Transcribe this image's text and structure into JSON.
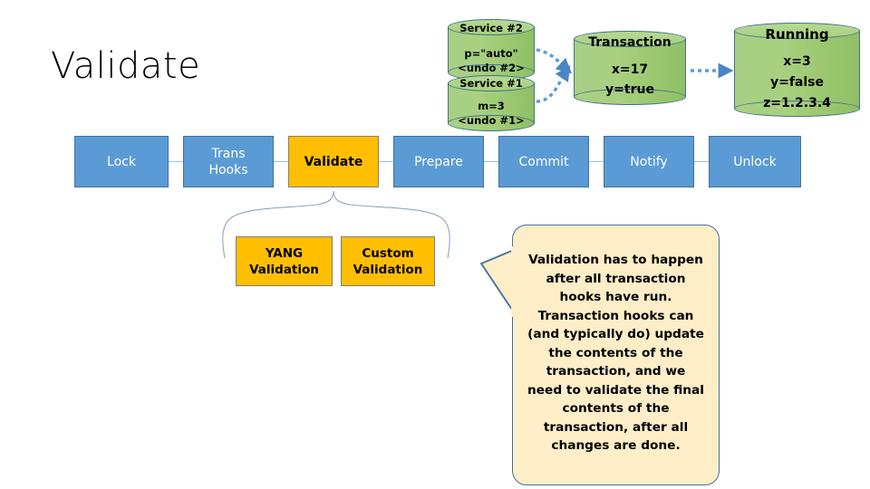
{
  "title": "Validate",
  "cylinders": [
    {
      "id": "service2",
      "name": "Service #2",
      "lines": [
        "p=\"auto\"",
        "<undo #2>"
      ]
    },
    {
      "id": "service1",
      "name": "Service #1",
      "lines": [
        "m=3",
        "<undo #1>"
      ]
    },
    {
      "id": "transaction",
      "name": "Transaction",
      "lines": [
        "x=17",
        "y=true"
      ]
    },
    {
      "id": "running",
      "name": "Running",
      "lines": [
        "x=3",
        "y=false",
        "z=1.2.3.4"
      ]
    }
  ],
  "pipeline": {
    "stages": [
      {
        "label": "Lock",
        "highlight": false
      },
      {
        "label": "Trans\nHooks",
        "highlight": false
      },
      {
        "label": "Validate",
        "highlight": true
      },
      {
        "label": "Prepare",
        "highlight": false
      },
      {
        "label": "Commit",
        "highlight": false
      },
      {
        "label": "Notify",
        "highlight": false
      },
      {
        "label": "Unlock",
        "highlight": false
      }
    ]
  },
  "sub_validation": [
    {
      "label": "YANG\nValidation"
    },
    {
      "label": "Custom\nValidation"
    }
  ],
  "callout": {
    "text": "Validation has to happen after all transaction hooks have run. Transaction hooks can (and typically do) update the contents of the transaction, and we need to validate the final contents of the transaction, after all changes are done."
  },
  "colors": {
    "stage_blue": "#5B9BD5",
    "stage_blue_border": "#41719C",
    "highlight_amber": "#FFBF00",
    "highlight_border": "#7F7F7F",
    "cylinder_green": "#A9D07F",
    "cylinder_border": "#43738C",
    "callout_cream": "#FDEEC8",
    "callout_border": "#41719C",
    "arrow_blue": "#5B9BD5",
    "brace_gray": "#8FA7B8"
  }
}
